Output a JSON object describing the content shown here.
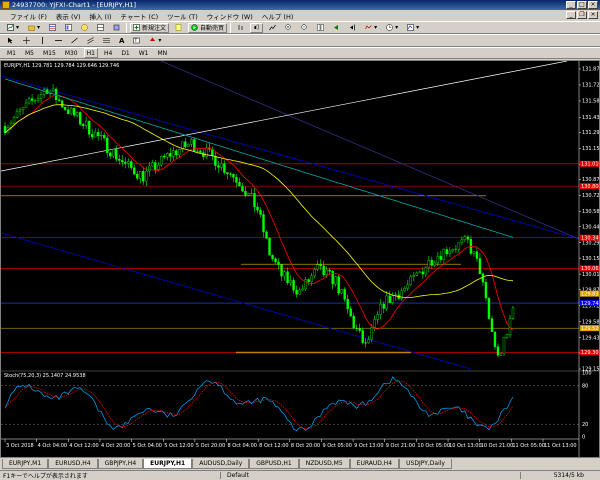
{
  "window": {
    "title": "24937700: YJFX!-Chart1 - [EURJPY,H1]"
  },
  "menu": {
    "items": [
      "ファイル (F)",
      "表示 (V)",
      "挿入 (I)",
      "チャート (C)",
      "ツール (T)",
      "ウィンドウ (W)",
      "ヘルプ (H)"
    ]
  },
  "toolbar": {
    "new_order_label": "新規注文",
    "auto_trade_label": "自動売買",
    "timeframes": [
      "M1",
      "M5",
      "M15",
      "M30",
      "H1",
      "H4",
      "D1",
      "W1",
      "MN"
    ]
  },
  "chart": {
    "symbol_info": "EURJPY,H1  129.781 129.784 129.646 129.746",
    "stoch_info": "Stoch(75,20,3) 25.1407 24.9538",
    "price_ticks": [
      "131.870",
      "131.725",
      "131.580",
      "131.430",
      "131.295",
      "131.150",
      "131.005",
      "130.870",
      "130.725",
      "130.580",
      "130.440",
      "130.295",
      "130.155",
      "130.010",
      "129.870",
      "129.725",
      "129.580",
      "129.435",
      "129.295",
      "129.150"
    ],
    "price_labels": [
      {
        "text": "131.010",
        "color": "#e00000"
      },
      {
        "text": "130.808",
        "color": "#e00000"
      },
      {
        "text": "130.340",
        "color": "#e00000"
      },
      {
        "text": "130.062",
        "color": "#e00000"
      },
      {
        "text": "129.833",
        "color": "#e0a000"
      },
      {
        "text": "129.748",
        "color": "#0000ff"
      },
      {
        "text": "129.520",
        "color": "#e0a000"
      },
      {
        "text": "129.301",
        "color": "#e00000"
      }
    ],
    "stoch_ticks": [
      "100",
      "80",
      "20",
      "0"
    ],
    "time_ticks": [
      "3 Oct 2018",
      "4 Oct 04:00",
      "4 Oct 12:00",
      "4 Oct 20:00",
      "5 Oct 04:00",
      "5 Oct 12:00",
      "5 Oct 20:00",
      "8 Oct 04:00",
      "8 Oct 12:00",
      "8 Oct 20:00",
      "9 Oct 05:00",
      "9 Oct 13:00",
      "9 Oct 21:00",
      "10 Oct 05:00",
      "10 Oct 13:00",
      "10 Oct 21:00",
      "11 Oct 05:00",
      "11 Oct 13:00"
    ],
    "colors": {
      "background": "#000000",
      "candle": "#00ff00",
      "resistance": "#ff0000",
      "ma_fast": "#ff0000",
      "ma_mid": "#ffff00",
      "ma_slow": "#00aaaa",
      "channel": "#0000cc",
      "trend_white": "#ffffff",
      "stoch_main": "#00aaff",
      "stoch_signal": "#ff0000"
    }
  },
  "tabs": [
    "EURJPY,M1",
    "EURUSD,H4",
    "GBPJPY,H4",
    "EURJPY,H1",
    "AUDUSD,Daily",
    "GBPUSD,H1",
    "NZDUSD,M5",
    "EURAUD,H4",
    "USDJPY,Daily"
  ],
  "active_tab": "EURJPY,H1",
  "status": {
    "help": "F1キーでヘルプが表示されます",
    "profile": "Default",
    "traffic": "5314/5 kb"
  }
}
